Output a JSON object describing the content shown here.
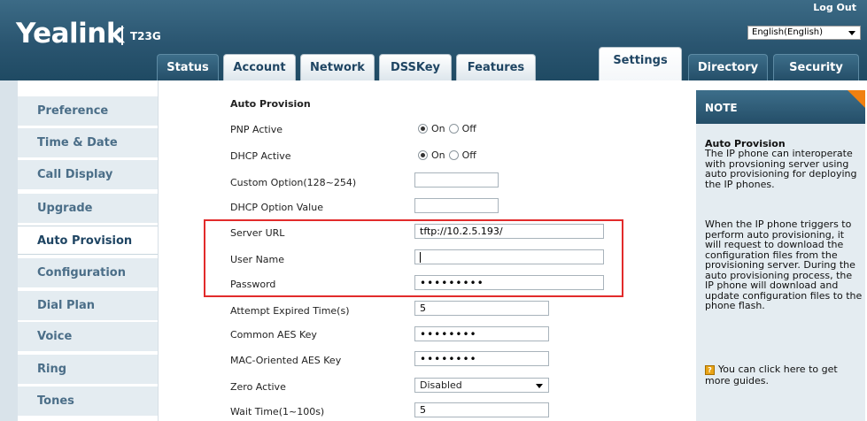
{
  "header": {
    "logo": "Yealink",
    "model": "T23G",
    "logout": "Log Out",
    "language": "English(English)"
  },
  "tabs": [
    "Status",
    "Account",
    "Network",
    "DSSKey",
    "Features",
    "Settings",
    "Directory",
    "Security"
  ],
  "active_tab": "Settings",
  "sidebar": {
    "items": [
      "Preference",
      "Time & Date",
      "Call Display",
      "Upgrade",
      "Auto Provision",
      "Configuration",
      "Dial Plan",
      "Voice",
      "Ring",
      "Tones"
    ],
    "active": "Auto Provision"
  },
  "form": {
    "section_title": "Auto Provision",
    "pnp_active": {
      "label": "PNP Active",
      "on": "On",
      "off": "Off",
      "value": "On"
    },
    "dhcp_active": {
      "label": "DHCP Active",
      "on": "On",
      "off": "Off",
      "value": "On"
    },
    "custom_option": {
      "label": "Custom Option(128~254)",
      "value": ""
    },
    "dhcp_option_value": {
      "label": "DHCP Option Value",
      "value": ""
    },
    "server_url": {
      "label": "Server URL",
      "value": "tftp://10.2.5.193/"
    },
    "user_name": {
      "label": "User Name",
      "value": ""
    },
    "password": {
      "label": "Password",
      "value": "•••••••••"
    },
    "attempt_expired_time": {
      "label": "Attempt Expired Time(s)",
      "value": "5"
    },
    "common_aes_key": {
      "label": "Common AES Key",
      "value": "••••••••"
    },
    "mac_aes_key": {
      "label": "MAC-Oriented AES Key",
      "value": "••••••••"
    },
    "zero_active": {
      "label": "Zero Active",
      "value": "Disabled"
    },
    "wait_time": {
      "label": "Wait Time(1~100s)",
      "value": "5"
    }
  },
  "note": {
    "header": "NOTE",
    "title": "Auto Provision",
    "para1": "The IP phone can interoperate with provsioning server using auto provisioning for deploying the IP phones.",
    "para2": "When the IP phone triggers to perform auto provisioning, it will request to download the configuration files from the provisioning server. During the auto provisioning process, the IP phone will download and update configuration files to the phone flash.",
    "link": "You can click here to get more guides."
  },
  "colors": {
    "header_bg": "#2a5570",
    "highlight": "#e22b2b",
    "note_corner": "#f08010"
  }
}
